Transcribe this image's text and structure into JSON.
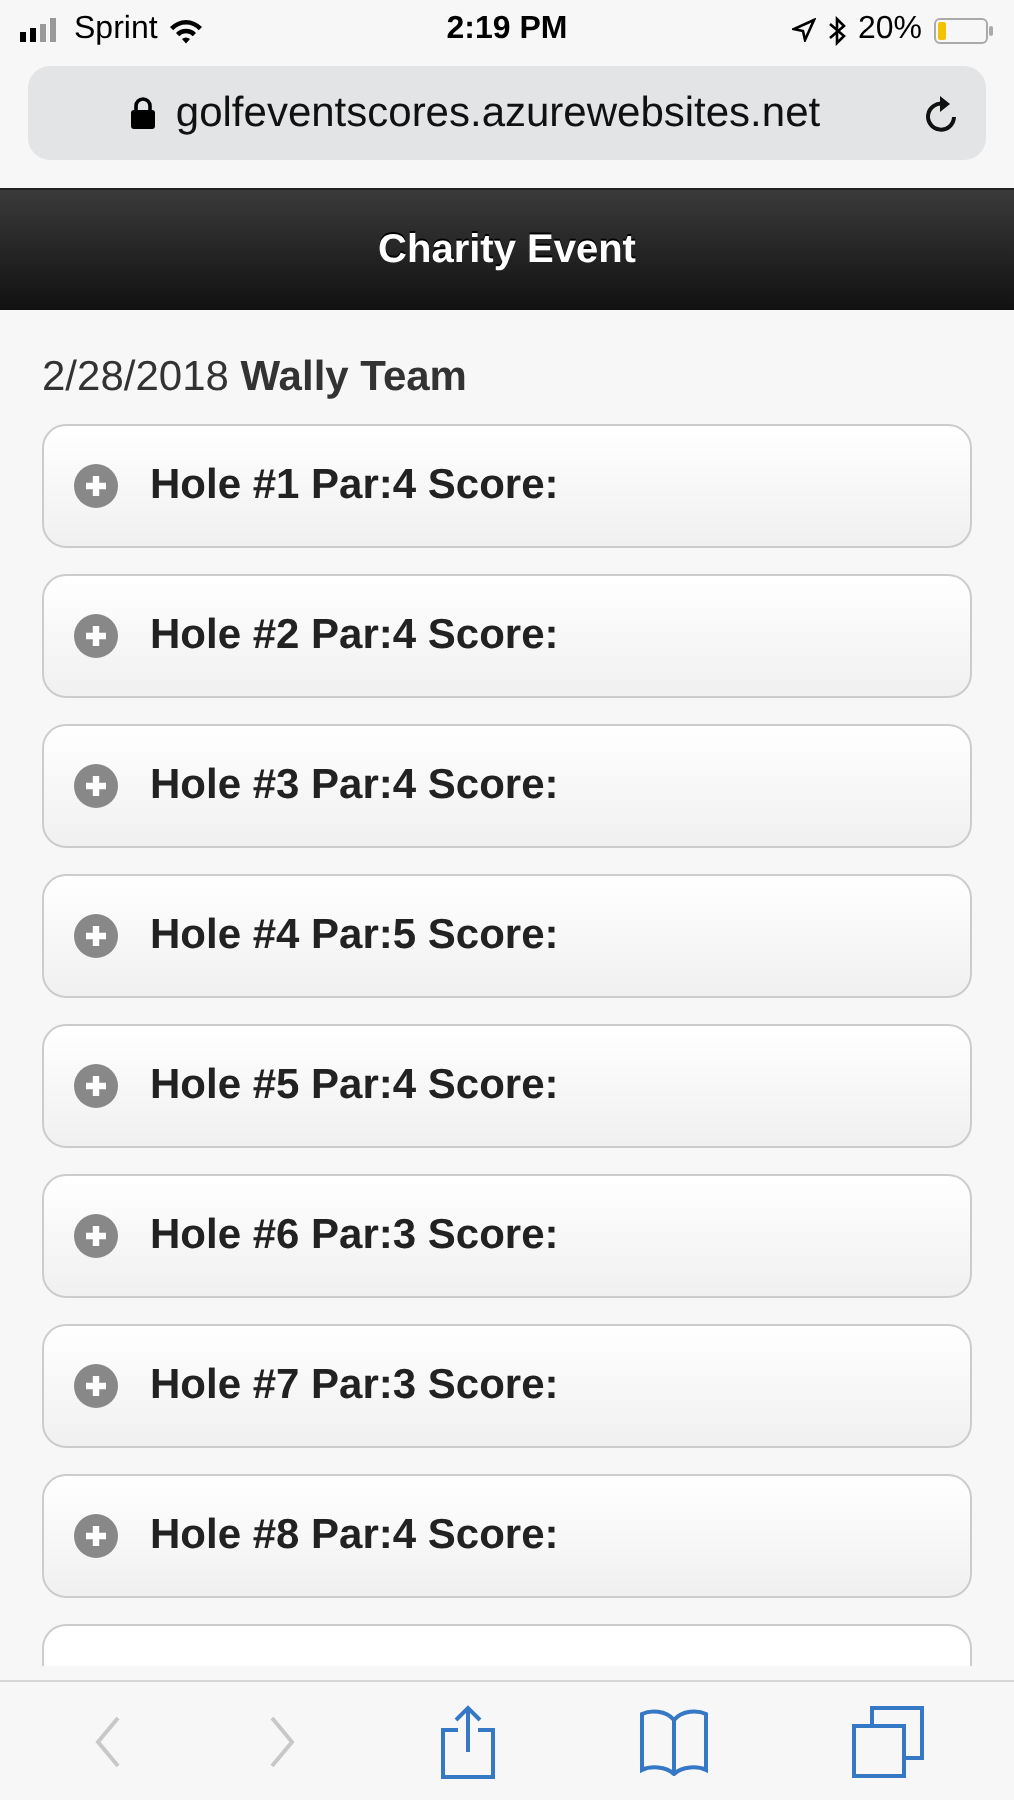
{
  "status_bar": {
    "carrier": "Sprint",
    "time": "2:19 PM",
    "battery": "20%"
  },
  "address_bar": {
    "url": "golfeventscores.azurewebsites.net"
  },
  "header": {
    "title": "Charity Event"
  },
  "subtitle": "2/28/2018 **Wally Team**",
  "holes": [
    {
      "label": "Hole #1 Par:4 Score:",
      "expanded": false
    },
    {
      "label": "Hole #2 Par:4 Score:",
      "expanded": false
    },
    {
      "label": "Hole #3 Par:4 Score:",
      "expanded": false
    },
    {
      "label": "Hole #4 Par:5 Score:",
      "expanded": false
    },
    {
      "label": "Hole #5 Par:4 Score:",
      "expanded": false
    },
    {
      "label": "Hole #6 Par:3 Score:",
      "expanded": false
    },
    {
      "label": "Hole #7 Par:3 Score:",
      "expanded": false
    },
    {
      "label": "Hole #8 Par:4 Score:",
      "expanded": false
    }
  ],
  "toolbar": {
    "back_disabled": true,
    "forward_disabled": true
  }
}
